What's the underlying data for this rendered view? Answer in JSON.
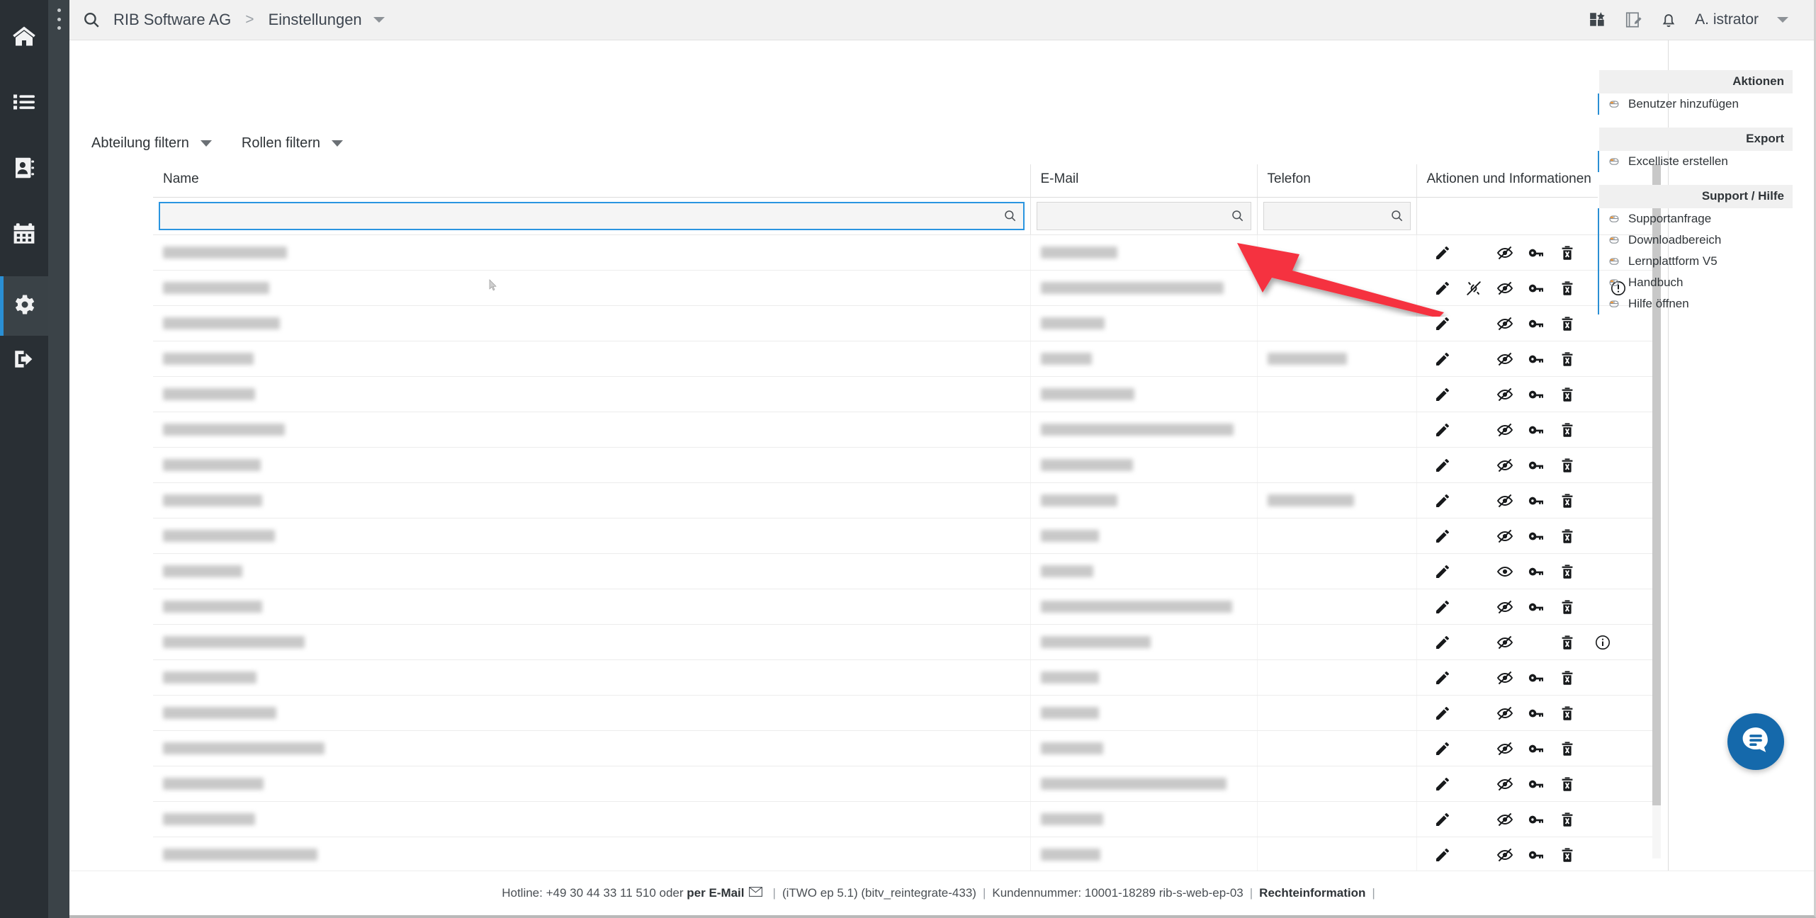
{
  "app": {
    "breadcrumb": {
      "root": "RIB Software AG",
      "separator": ">",
      "current": "Einstellungen"
    },
    "user": {
      "name": "A. istrator"
    },
    "topbar_icons": [
      "search-icon",
      "apps-icon",
      "notes-icon",
      "bell-icon",
      "chevron-down-icon"
    ]
  },
  "sidebar": {
    "items": [
      {
        "name": "home",
        "icon": "home-icon",
        "active": false
      },
      {
        "name": "list",
        "icon": "list-icon",
        "active": false
      },
      {
        "name": "contacts",
        "icon": "address-book-icon",
        "active": false
      },
      {
        "name": "calendar",
        "icon": "calendar-icon",
        "active": false
      },
      {
        "name": "settings",
        "icon": "gear-icon",
        "active": true
      },
      {
        "name": "logout",
        "icon": "logout-icon",
        "active": false
      }
    ],
    "accent": "#2a8fd4"
  },
  "filters": [
    {
      "label": "Abteilung filtern"
    },
    {
      "label": "Rollen filtern"
    }
  ],
  "table": {
    "columns": [
      "Name",
      "E-Mail",
      "Telefon",
      "Aktionen und Informationen"
    ],
    "filter_inputs": [
      {
        "column": "Name",
        "value": "",
        "placeholder": "",
        "focused": true
      },
      {
        "column": "E-Mail",
        "value": "",
        "placeholder": "",
        "focused": false
      },
      {
        "column": "Telefon",
        "value": "",
        "placeholder": "",
        "focused": false
      }
    ],
    "rows": [
      {
        "name_w": 175,
        "mail_w": 108,
        "tel_w": 0,
        "actions": [
          "edit",
          "eye-off",
          "key",
          "trash"
        ],
        "info": ""
      },
      {
        "name_w": 150,
        "mail_w": 258,
        "tel_w": 0,
        "actions": [
          "edit",
          "broken-link",
          "eye-off",
          "key",
          "trash"
        ],
        "info": "warning"
      },
      {
        "name_w": 165,
        "mail_w": 90,
        "tel_w": 0,
        "actions": [
          "edit",
          "eye-off",
          "key",
          "trash"
        ],
        "info": ""
      },
      {
        "name_w": 128,
        "mail_w": 72,
        "tel_w": 112,
        "actions": [
          "edit",
          "eye-off",
          "key",
          "trash"
        ],
        "info": ""
      },
      {
        "name_w": 130,
        "mail_w": 132,
        "tel_w": 0,
        "actions": [
          "edit",
          "eye-off",
          "key",
          "trash"
        ],
        "info": ""
      },
      {
        "name_w": 172,
        "mail_w": 272,
        "tel_w": 0,
        "actions": [
          "edit",
          "eye-off",
          "key",
          "trash"
        ],
        "info": ""
      },
      {
        "name_w": 138,
        "mail_w": 130,
        "tel_w": 0,
        "actions": [
          "edit",
          "eye-off",
          "key",
          "trash"
        ],
        "info": ""
      },
      {
        "name_w": 140,
        "mail_w": 108,
        "tel_w": 122,
        "actions": [
          "edit",
          "eye-off",
          "key",
          "trash"
        ],
        "info": ""
      },
      {
        "name_w": 158,
        "mail_w": 82,
        "tel_w": 0,
        "actions": [
          "edit",
          "eye-off",
          "key",
          "trash"
        ],
        "info": ""
      },
      {
        "name_w": 112,
        "mail_w": 74,
        "tel_w": 0,
        "actions": [
          "edit",
          "eye-on",
          "key",
          "trash"
        ],
        "info": ""
      },
      {
        "name_w": 140,
        "mail_w": 270,
        "tel_w": 0,
        "actions": [
          "edit",
          "eye-off",
          "key",
          "trash"
        ],
        "info": ""
      },
      {
        "name_w": 200,
        "mail_w": 155,
        "tel_w": 0,
        "actions": [
          "edit",
          "eye-off",
          "trash"
        ],
        "info": "info"
      },
      {
        "name_w": 132,
        "mail_w": 82,
        "tel_w": 0,
        "actions": [
          "edit",
          "eye-off",
          "key",
          "trash"
        ],
        "info": ""
      },
      {
        "name_w": 160,
        "mail_w": 82,
        "tel_w": 0,
        "actions": [
          "edit",
          "eye-off",
          "key",
          "trash"
        ],
        "info": ""
      },
      {
        "name_w": 228,
        "mail_w": 88,
        "tel_w": 0,
        "actions": [
          "edit",
          "eye-off",
          "key",
          "trash"
        ],
        "info": ""
      },
      {
        "name_w": 142,
        "mail_w": 262,
        "tel_w": 0,
        "actions": [
          "edit",
          "eye-off",
          "key",
          "trash"
        ],
        "info": ""
      },
      {
        "name_w": 130,
        "mail_w": 88,
        "tel_w": 0,
        "actions": [
          "edit",
          "eye-off",
          "key",
          "trash"
        ],
        "info": ""
      },
      {
        "name_w": 218,
        "mail_w": 84,
        "tel_w": 0,
        "actions": [
          "edit",
          "eye-off",
          "key",
          "trash"
        ],
        "info": ""
      }
    ]
  },
  "right_panel": {
    "sections": [
      {
        "title": "Aktionen",
        "items": [
          {
            "label": "Benutzer hinzufügen",
            "icon": "click-icon"
          }
        ]
      },
      {
        "title": "Export",
        "items": [
          {
            "label": "Excelliste erstellen",
            "icon": "click-icon"
          }
        ]
      },
      {
        "title": "Support / Hilfe",
        "items": [
          {
            "label": "Supportanfrage",
            "icon": "click-icon"
          },
          {
            "label": "Downloadbereich",
            "icon": "click-icon"
          },
          {
            "label": "Lernplattform V5",
            "icon": "click-icon"
          },
          {
            "label": "Handbuch",
            "icon": "click-icon"
          },
          {
            "label": "Hilfe öffnen",
            "icon": "click-icon"
          }
        ]
      }
    ],
    "accent": "#2a8fd4"
  },
  "footer": {
    "hotline_prefix": "Hotline: +49 30 44 33 11 510 oder",
    "mail_link": "per E-Mail",
    "mail_icon": "envelope-icon",
    "version": "(iTWO ep 5.1) (bitv_reintegrate-433)",
    "customer": "Kundennummer: 10001-18289 rib-s-web-ep-03",
    "legal": "Rechteinformation",
    "sep": "|"
  },
  "chat": {
    "icon": "chat-bubble-icon",
    "color": "#1569ab"
  },
  "annotation": {
    "type": "red-arrow",
    "color": "#f5333f",
    "points_to": "edit-pencil-first-row"
  }
}
